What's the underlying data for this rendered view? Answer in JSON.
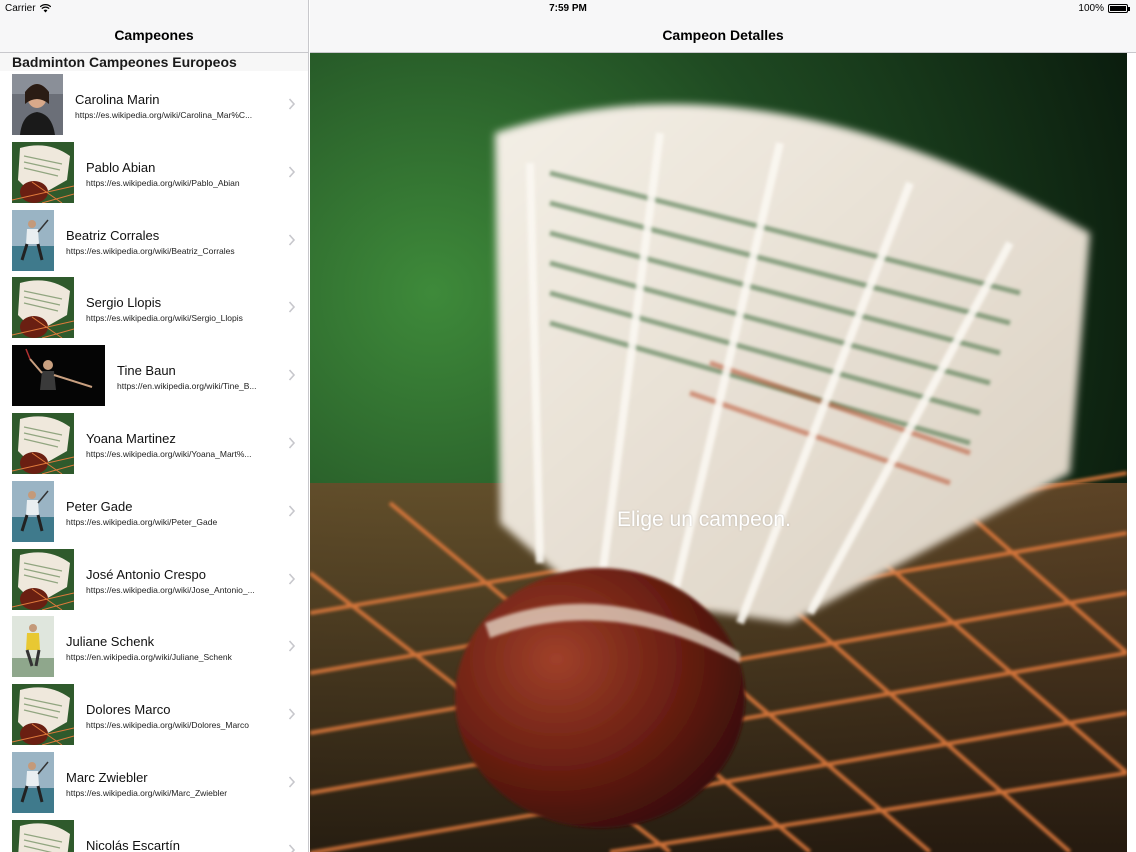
{
  "status": {
    "carrier": "Carrier",
    "time": "7:59 PM",
    "battery": "100%"
  },
  "master": {
    "title": "Campeones",
    "section": "Badminton Campeones Europeos",
    "items": [
      {
        "name": "Carolina Marin",
        "url": "https://es.wikipedia.org/wiki/Carolina_Mar%C...",
        "thumb": "portrait"
      },
      {
        "name": "Pablo Abian",
        "url": "https://es.wikipedia.org/wiki/Pablo_Abian",
        "thumb": "shuttlecock"
      },
      {
        "name": "Beatriz Corrales",
        "url": "https://es.wikipedia.org/wiki/Beatriz_Corrales",
        "thumb": "player-court"
      },
      {
        "name": "Sergio Llopis",
        "url": "https://es.wikipedia.org/wiki/Sergio_Llopis",
        "thumb": "shuttlecock"
      },
      {
        "name": "Tine Baun",
        "url": "https://en.wikipedia.org/wiki/Tine_B...",
        "thumb": "player-dark"
      },
      {
        "name": "Yoana Martinez",
        "url": "https://es.wikipedia.org/wiki/Yoana_Mart%...",
        "thumb": "shuttlecock"
      },
      {
        "name": "Peter Gade",
        "url": "https://es.wikipedia.org/wiki/Peter_Gade",
        "thumb": "player-court"
      },
      {
        "name": "José Antonio Crespo",
        "url": "https://es.wikipedia.org/wiki/Jose_Antonio_...",
        "thumb": "shuttlecock"
      },
      {
        "name": "Juliane Schenk",
        "url": "https://en.wikipedia.org/wiki/Juliane_Schenk",
        "thumb": "player-yellow"
      },
      {
        "name": "Dolores Marco",
        "url": "https://es.wikipedia.org/wiki/Dolores_Marco",
        "thumb": "shuttlecock"
      },
      {
        "name": "Marc Zwiebler",
        "url": "https://es.wikipedia.org/wiki/Marc_Zwiebler",
        "thumb": "player-court"
      },
      {
        "name": "Nicolás Escartín",
        "url": "",
        "thumb": "shuttlecock"
      }
    ]
  },
  "detail": {
    "title": "Campeon Detalles",
    "message": "Elige un campeon."
  }
}
